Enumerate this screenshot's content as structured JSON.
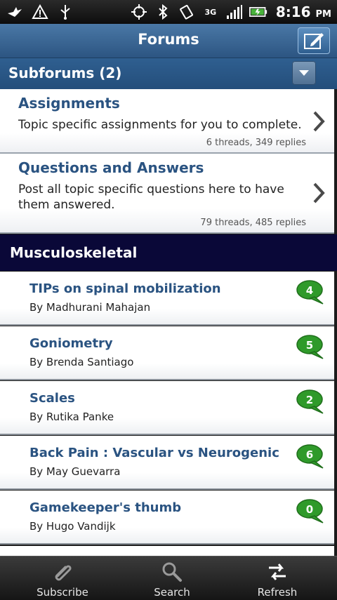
{
  "statusbar": {
    "time": "8:16",
    "ampm": "PM",
    "network": "3G"
  },
  "header": {
    "title": "Forums"
  },
  "subforums_header": {
    "label": "Subforums (2)"
  },
  "subforums": [
    {
      "name": "Assignments",
      "description": "Topic specific assignments for you to complete.",
      "stats": "6 threads, 349 replies"
    },
    {
      "name": "Questions and Answers",
      "description": "Post all topic specific questions here to have them answered.",
      "stats": "79 threads, 485 replies"
    }
  ],
  "section": {
    "label": "Musculoskeletal"
  },
  "threads": [
    {
      "title": "TIPs on spinal mobilization",
      "author": "By Madhurani Mahajan",
      "replies": "4"
    },
    {
      "title": "Goniometry",
      "author": "By Brenda Santiago",
      "replies": "5"
    },
    {
      "title": "Scales",
      "author": "By Rutika Panke",
      "replies": "2"
    },
    {
      "title": "Back Pain : Vascular vs Neurogenic",
      "author": "By May Guevarra",
      "replies": "6"
    },
    {
      "title": "Gamekeeper's thumb",
      "author": "By Hugo Vandijk",
      "replies": "0"
    }
  ],
  "bottombar": {
    "subscribe": "Subscribe",
    "search": "Search",
    "refresh": "Refresh"
  },
  "colors": {
    "title_blue": "#2a5381",
    "section_bg": "#0a0838",
    "bubble_green": "#2f9a2a"
  }
}
